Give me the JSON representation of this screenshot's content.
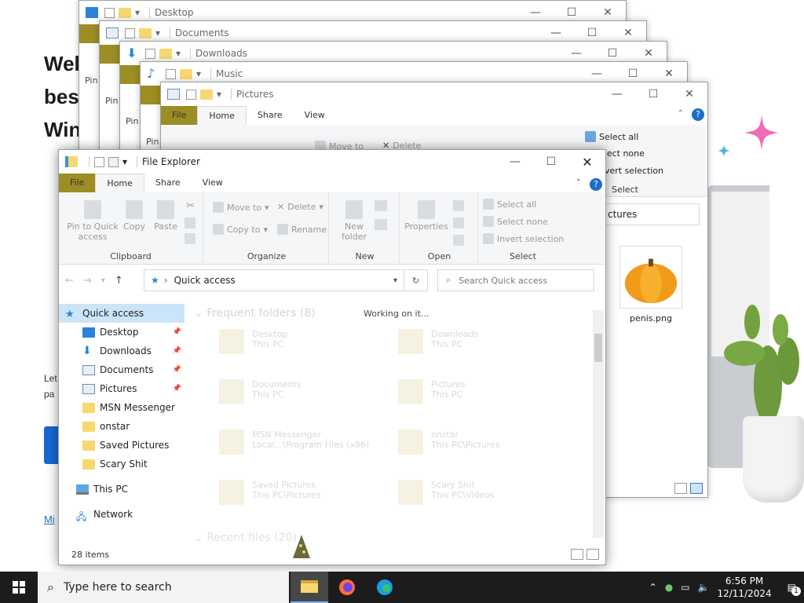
{
  "background": {
    "hero_lines": [
      "Welc",
      "best",
      "Win"
    ],
    "let_lines": [
      "Let",
      "pa"
    ],
    "link_text": "Mi"
  },
  "stacked_windows": [
    {
      "title": "Desktop"
    },
    {
      "title": "Documents"
    },
    {
      "title": "Downloads"
    },
    {
      "title": "Music"
    },
    {
      "title": "Pictures"
    }
  ],
  "pictures_window": {
    "tabs": [
      "File",
      "Home",
      "Share",
      "View"
    ],
    "select_group": [
      "Select all",
      "elect none",
      "nvert selection",
      "Select"
    ],
    "moveto": "Move to",
    "delete": "Delete",
    "address_tail": "ctures",
    "file_name": "penis.png"
  },
  "left_sliver_text": [
    "Pin",
    "Pin",
    "Pin",
    "Pin"
  ],
  "main": {
    "title": "File Explorer",
    "tabs": {
      "file": "File",
      "home": "Home",
      "share": "Share",
      "view": "View"
    },
    "clipboard": {
      "pin": "Pin to Quick access",
      "copy": "Copy",
      "paste": "Paste",
      "label": "Clipboard"
    },
    "organize": {
      "move_to": "Move to",
      "copy_to": "Copy to",
      "delete": "Delete",
      "rename": "Rename",
      "label": "Organize"
    },
    "new": {
      "new_folder": "New folder",
      "label": "New"
    },
    "open": {
      "properties": "Properties",
      "label": "Open"
    },
    "select": {
      "select_all": "Select all",
      "select_none": "Select none",
      "invert": "Invert selection",
      "label": "Select"
    },
    "address": "Quick access",
    "search_placeholder": "Search Quick access",
    "nav": [
      {
        "label": "Quick access",
        "pinned": false
      },
      {
        "label": "Desktop",
        "pinned": true
      },
      {
        "label": "Downloads",
        "pinned": true
      },
      {
        "label": "Documents",
        "pinned": true
      },
      {
        "label": "Pictures",
        "pinned": true
      },
      {
        "label": "MSN Messenger",
        "pinned": false
      },
      {
        "label": "onstar",
        "pinned": false
      },
      {
        "label": "Saved Pictures",
        "pinned": false
      },
      {
        "label": "Scary Shit",
        "pinned": false
      },
      {
        "label": "This PC",
        "pinned": false
      },
      {
        "label": "Network",
        "pinned": false
      }
    ],
    "frequent_header": "Frequent folders (8)",
    "working": "Working on it...",
    "tiles": [
      {
        "name": "Desktop",
        "loc": "This PC"
      },
      {
        "name": "Downloads",
        "loc": "This PC"
      },
      {
        "name": "Documents",
        "loc": "This PC"
      },
      {
        "name": "Pictures",
        "loc": "This PC"
      },
      {
        "name": "MSN Messenger",
        "loc": "Local...\\Program Files (x86)"
      },
      {
        "name": "onstar",
        "loc": "This PC\\Pictures"
      },
      {
        "name": "Saved Pictures",
        "loc": "This PC\\Pictures"
      },
      {
        "name": "Scary Shit",
        "loc": "This PC\\Videos"
      }
    ],
    "recent_header": "Recent files (20)",
    "status": "28 items"
  },
  "taskbar": {
    "search_placeholder": "Type here to search",
    "time": "6:56 PM",
    "date": "12/11/2024",
    "notif_count": "1"
  },
  "colors": {
    "file_tab": "#9c8e24",
    "selection": "#cce4f7",
    "taskbar": "#1c1c1c"
  }
}
